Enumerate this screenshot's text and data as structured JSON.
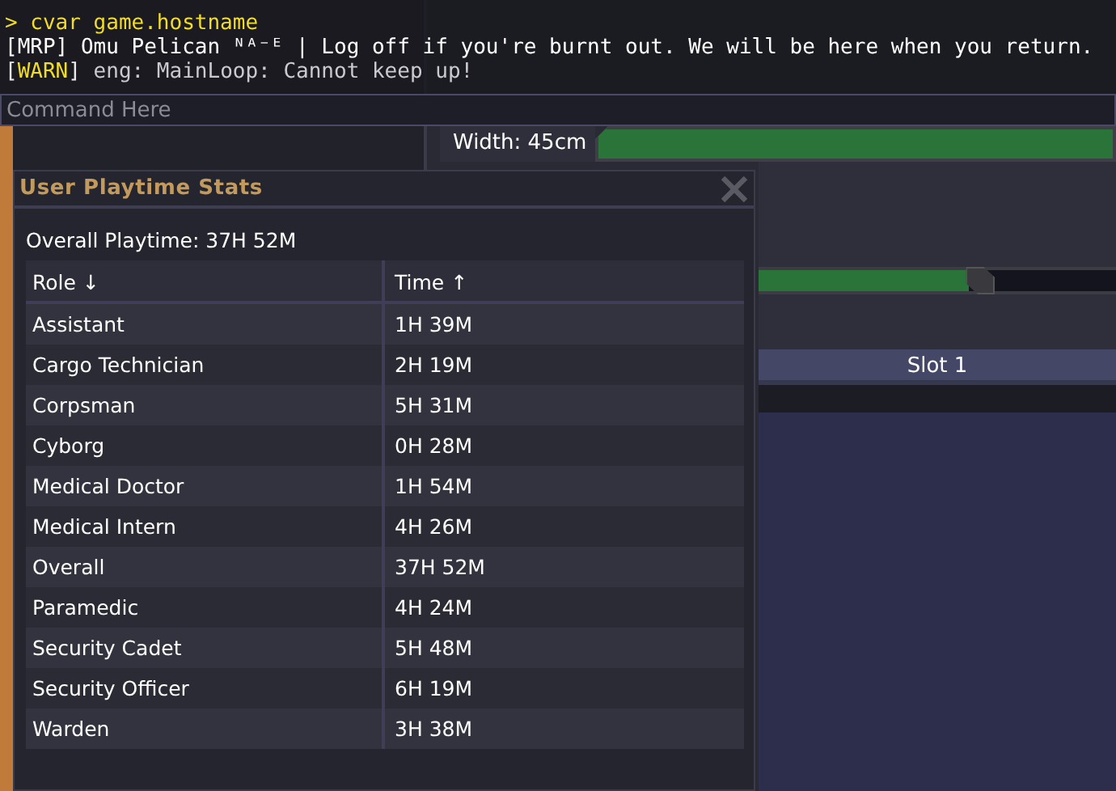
{
  "console": {
    "lines": [
      {
        "kind": "command",
        "prompt": ">",
        "text": "cvar game.hostname"
      },
      {
        "kind": "output",
        "text": "[MRP] Omu Pelican ᴺᴬ⁻ᴱ | Log off if you're burnt out. We will be here when you return."
      },
      {
        "kind": "warning",
        "open": "[",
        "tag": "WARN",
        "close": "]",
        "text": "eng: MainLoop: Cannot keep up!"
      }
    ],
    "input": {
      "placeholder": "Command Here"
    }
  },
  "profile": {
    "width_label": "Width: 45cm",
    "slider": {
      "level": 0.59
    },
    "slot": "Slot 1"
  },
  "window": {
    "title": "User Playtime Stats",
    "overall": "Overall Playtime: 37H 52M",
    "columns": [
      {
        "label": "Role ↓"
      },
      {
        "label": "Time ↑"
      }
    ],
    "rows": [
      {
        "role": "Assistant",
        "time": "1H 39M"
      },
      {
        "role": "Cargo Technician",
        "time": "2H 19M"
      },
      {
        "role": "Corpsman",
        "time": "5H 31M"
      },
      {
        "role": "Cyborg",
        "time": "0H 28M"
      },
      {
        "role": "Medical Doctor",
        "time": "1H 54M"
      },
      {
        "role": "Medical Intern",
        "time": "4H 26M"
      },
      {
        "role": "Overall",
        "time": "37H 52M"
      },
      {
        "role": "Paramedic",
        "time": "4H 24M"
      },
      {
        "role": "Security Cadet",
        "time": "5H 48M"
      },
      {
        "role": "Security Officer",
        "time": "6H 19M"
      },
      {
        "role": "Warden",
        "time": "3H 38M"
      }
    ]
  }
}
